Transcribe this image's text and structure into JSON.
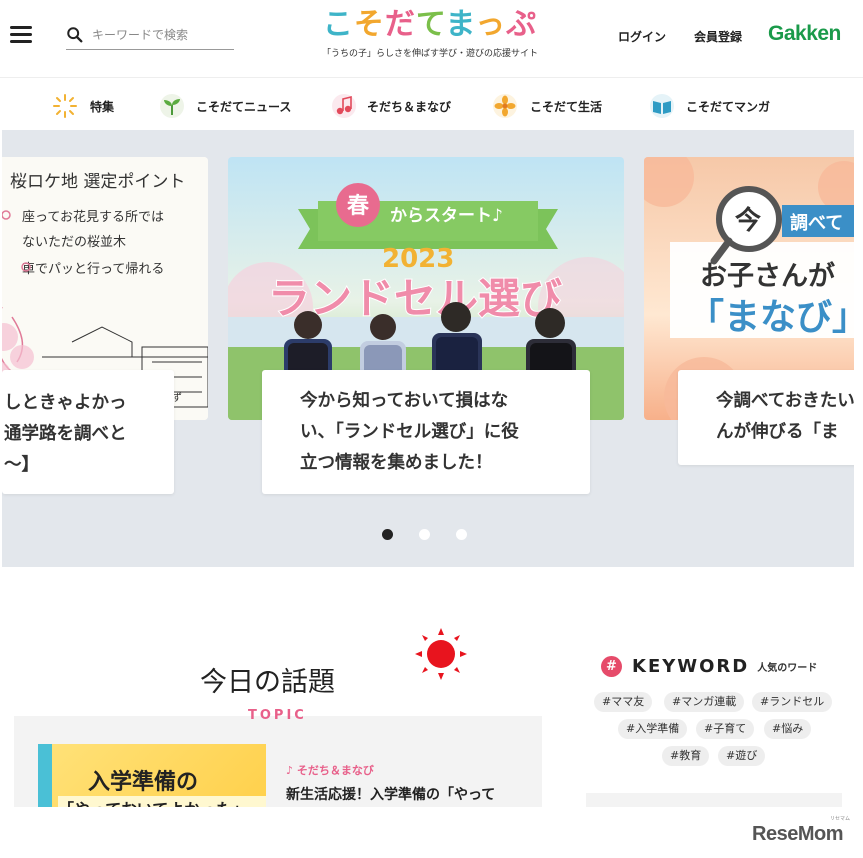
{
  "header": {
    "search_placeholder": "キーワードで検索",
    "logo_title": "こそだてまっぷ",
    "logo_tagline": "「うちの子」らしさを伸ばす学び・遊びの応援サイト",
    "login": "ログイン",
    "register": "会員登録",
    "brand": "Gakken"
  },
  "nav": {
    "items": [
      {
        "label": "特集",
        "icon": "sparkle-icon"
      },
      {
        "label": "こそだてニュース",
        "icon": "sprout-icon"
      },
      {
        "label": "そだち＆まなび",
        "icon": "music-note-icon"
      },
      {
        "label": "こそだて生活",
        "icon": "flower-icon"
      },
      {
        "label": "こそだてマンガ",
        "icon": "book-icon"
      }
    ]
  },
  "carousel": {
    "left": {
      "art_heading": "桜ロケ地 選定ポイント",
      "art_line1": "座ってお花見する所では",
      "art_line2": "ないただの桜並木",
      "art_line3": "車でパッと行って帰れる",
      "art_small": "ず",
      "card": "しときゃよかっ\n通学路を調べと\n～】"
    },
    "middle": {
      "ribbon_kanji": "春",
      "ribbon_text": "からスタート♪",
      "year": "2023",
      "title": "ランドセル選び",
      "card": "今から知っておいて損はな\nい、「ランドセル選び」に役\n立つ情報を集めました！"
    },
    "right": {
      "badge": "今",
      "badge_text": "調べて",
      "line1": "お子さんが",
      "line2": "「まなび」",
      "card": "今調べておきたい\nんが伸びる「ま"
    },
    "pages": 3,
    "active_page": 1
  },
  "topic": {
    "title": "今日の話題",
    "subtitle": "TOPIC",
    "thumb_line1": "入学準備の",
    "thumb_line2": "「やっておいてよかった」",
    "category": "♪ そだち＆まなび",
    "headline": "新生活応援！入学準備の「やって"
  },
  "keyword": {
    "title": "KEYWORD",
    "subtitle": "人気のワード",
    "tags": [
      "#ママ友",
      "#マンガ連載",
      "#ランドセル",
      "#入学準備",
      "#子育て",
      "#悩み",
      "#教育",
      "#遊び"
    ]
  },
  "footer": {
    "watermark": "ReseMom",
    "watermark_small": "リセマム"
  },
  "colors": {
    "accent_pink": "#e8608a",
    "brand_green": "#1a9a4a",
    "carousel_bg": "#e3e7ec"
  }
}
